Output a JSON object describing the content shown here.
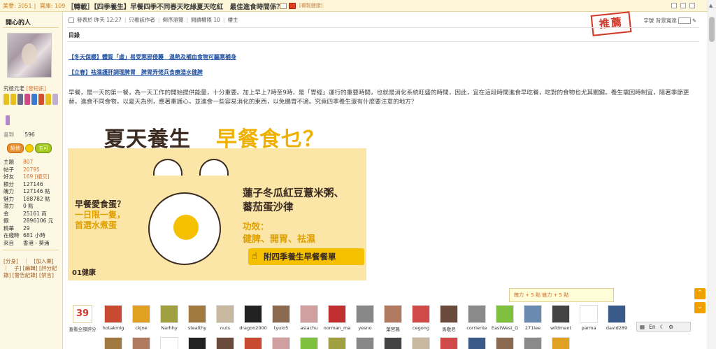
{
  "topbar": {
    "stat1": "美譽: 3051",
    "stat2": "寶庫: 109",
    "title": "［轉載］【四季養生】早餐四季不同春天吃綠夏天吃紅　最佳進食時間係？",
    "copy_link": "[複製鏈接]"
  },
  "user": {
    "name": "開心的人",
    "rank_label": "究極元老",
    "rank_link": "[發短訊]",
    "likes_label": "喜到",
    "likes_value": "596",
    "vote_left": "給他",
    "vote_right": "五可",
    "stats": [
      {
        "k": "主題",
        "v": "807"
      },
      {
        "k": "帖子",
        "v": "20795"
      },
      {
        "k": "好友",
        "v": "169 [絕交]"
      },
      {
        "k": "積分",
        "v": "127146"
      },
      {
        "k": "魄力",
        "v": "127146 點"
      },
      {
        "k": "魅力",
        "v": "188782 點"
      },
      {
        "k": "潛力",
        "v": "0 點"
      },
      {
        "k": "金",
        "v": "25161 両"
      },
      {
        "k": "銀",
        "v": "2896106 元"
      },
      {
        "k": "精華",
        "v": "29"
      },
      {
        "k": "在綫時",
        "v": "681 小時"
      },
      {
        "k": "來自",
        "v": "香港 - 葵涌"
      }
    ],
    "links": "[分身]　｜　[加入樂]　｜　子] [編輯] [評分紀錄] [警告紀錄] [禁言]"
  },
  "post": {
    "meta": [
      "發表於 昨天 12:27",
      "只看該作者",
      "倒序瀏覽",
      "閱讀權限 10",
      "樓主"
    ],
    "bg_label": "字號 背景寬達",
    "stamp": "推薦",
    "toc": "目錄",
    "link1": "【冬天保暖】體質「虛」易受寒邪侵襲　溫熱及補血食物可驅寒補身",
    "link2": "【立春】祛濕護肝調理脾胃　脾胃弄佬兵食療湯水健脾",
    "paragraph": "早餐，是一天的第一餐，為一天工作的開始提供能量，十分重要。加上早上7時至9時，是「胃經」運行的重要時間，也就是消化系統旺盛的時間，因此，宜在這段時間進食早吃餐，吃對的食物也尤其關鍵。養生需因時制宜，隨著季節更替，進食不同食物，以夏天為例，應著重護心，並進食一些容易消化的東西，以免腸胃不適。究竟四季養生還有什麼要注意的地方？"
  },
  "ad": {
    "t1": "夏天養生",
    "t2": "早餐食乜？",
    "left_lines": [
      "早餐愛食蛋？",
      "一日限一隻，",
      "首選水煮蛋"
    ],
    "right_lines": [
      "蓮子冬瓜紅豆薏米粥、",
      "蕃茄蛋沙律"
    ],
    "effect_label": "功效：",
    "effect_text": "健脾、開胃、祛濕",
    "button": "附四季養生早餐餐單",
    "logo": "01健康"
  },
  "tooltip": "魄力 + 5 點 魅力 + 5 點",
  "rating": {
    "count": "39",
    "label": "查看全部評分"
  },
  "raters": [
    "hotakmig",
    "ckjoe",
    "Narhhy",
    "stealthy",
    "nuts",
    "dragon2000",
    "tyuio5",
    "asiachu",
    "norman_ma",
    "yesno",
    "葉宮鴉",
    "cegong",
    "馬敬尼",
    "corriente",
    "EastWest_G",
    "271lee",
    "wildmant",
    "parma",
    "david289"
  ],
  "colors": {
    "accent": "#f0a000",
    "brand_red": "#d03828",
    "link": "#2050a0",
    "sidebar_bg": "#fdf8e4"
  }
}
